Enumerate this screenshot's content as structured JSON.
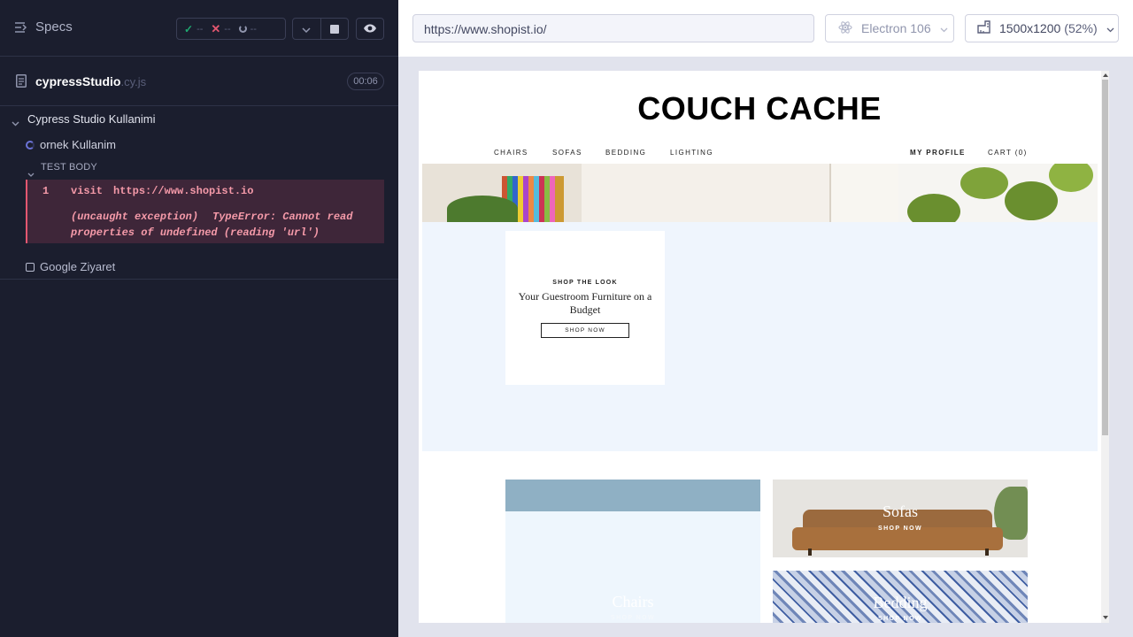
{
  "reporter": {
    "specs_label": "Specs",
    "stats": {
      "passed": "--",
      "failed": "--",
      "pending": "--"
    },
    "spec": {
      "name": "cypressStudio",
      "ext": ".cy.js",
      "duration": "00:06"
    },
    "suite": {
      "title": "Cypress Studio Kullanimi"
    },
    "test": {
      "title": "ornek Kullanim",
      "state": "running"
    },
    "test_body_label": "TEST BODY",
    "command": {
      "number": "1",
      "name": "visit",
      "message": "https://www.shopist.io",
      "exception_label": "(uncaught exception)",
      "error_message": "TypeError: Cannot read properties of undefined (reading 'url')"
    },
    "skipped_test": {
      "title": "Google Ziyaret"
    }
  },
  "aut": {
    "url": "https://www.shopist.io/",
    "browser": "Electron 106",
    "viewport": {
      "size": "1500x1200",
      "scale": "(52%)"
    },
    "site": {
      "brand": "COUCH CACHE",
      "nav": [
        "CHAIRS",
        "SOFAS",
        "BEDDING",
        "LIGHTING"
      ],
      "nav_right": [
        "MY PROFILE",
        "CART (0)"
      ],
      "look": {
        "kicker": "SHOP THE LOOK",
        "title": "Your Guestroom Furniture on a Budget",
        "button": "SHOP NOW"
      },
      "tiles": [
        {
          "label": "Chairs",
          "cta": "SHOP NOW"
        },
        {
          "label": "Sofas",
          "cta": "SHOP NOW"
        },
        {
          "label": "Bedding",
          "cta": "SHOP NOW"
        }
      ]
    }
  },
  "colors": {
    "reporter_bg": "#1b1e2e",
    "pass": "#1fa971",
    "fail": "#e45770",
    "running": "#6b73d8",
    "error_text": "#f59aa9"
  },
  "icons": [
    "specs-list-icon",
    "check-icon",
    "x-icon",
    "pending-icon",
    "chevron-down-icon",
    "stop-icon",
    "eye-icon",
    "file-icon",
    "electron-icon",
    "ruler-icon"
  ]
}
